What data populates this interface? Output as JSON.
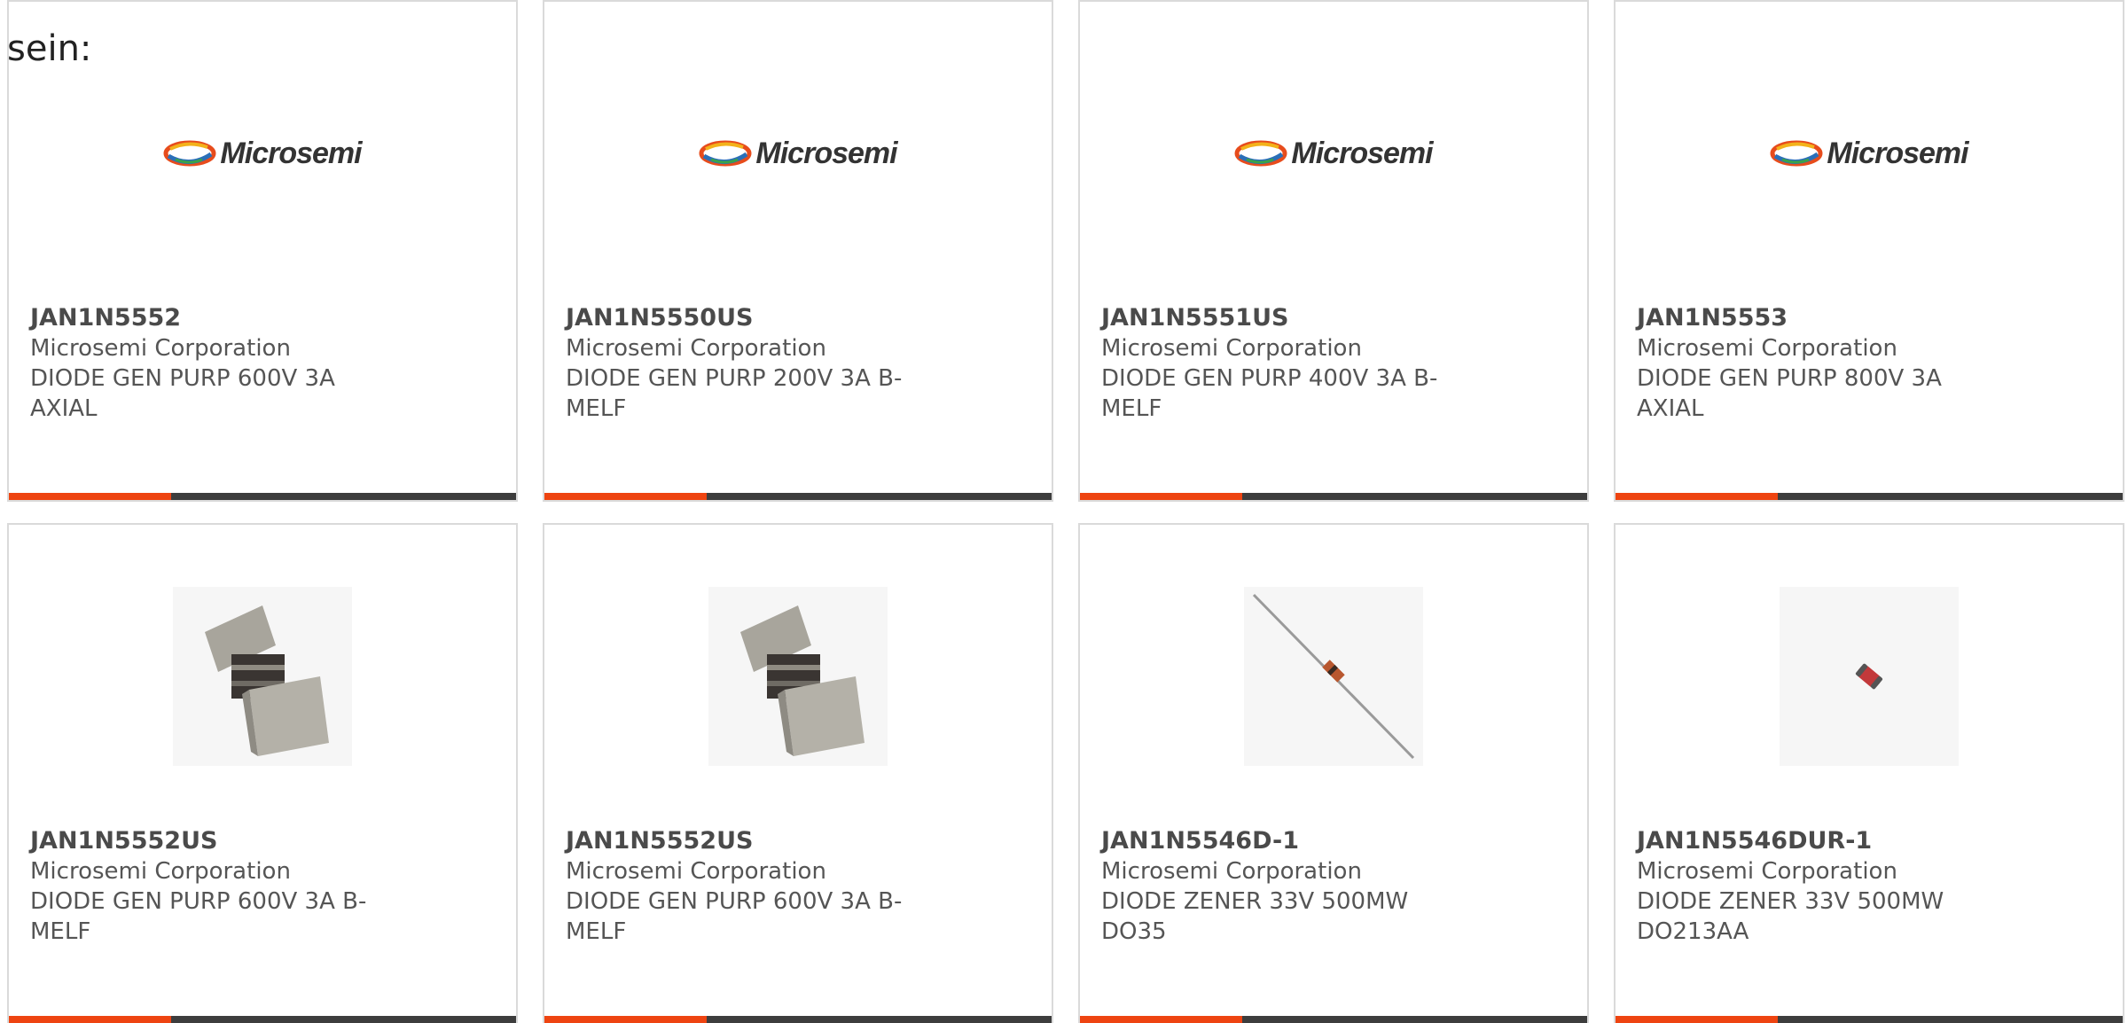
{
  "intro_text": "sein:",
  "logo_text": "Microsemi",
  "colors": {
    "accent": "#ee4411",
    "bar": "#3d3d3d",
    "border": "#dadada",
    "text": "#555555"
  },
  "cards": [
    {
      "part": "JAN1N5552",
      "manufacturer": "Microsemi Corporation",
      "description": "DIODE GEN PURP 600V 3A AXIAL",
      "image": "microsemi-logo"
    },
    {
      "part": "JAN1N5550US",
      "manufacturer": "Microsemi Corporation",
      "description": "DIODE GEN PURP 200V 3A B-MELF",
      "image": "microsemi-logo"
    },
    {
      "part": "JAN1N5551US",
      "manufacturer": "Microsemi Corporation",
      "description": "DIODE GEN PURP 400V 3A B-MELF",
      "image": "microsemi-logo"
    },
    {
      "part": "JAN1N5553",
      "manufacturer": "Microsemi Corporation",
      "description": "DIODE GEN PURP 800V 3A AXIAL",
      "image": "microsemi-logo"
    },
    {
      "part": "JAN1N5552US",
      "manufacturer": "Microsemi Corporation",
      "description": "DIODE GEN PURP 600V 3A B-MELF",
      "image": "b-melf-diode-photo"
    },
    {
      "part": "JAN1N5552US",
      "manufacturer": "Microsemi Corporation",
      "description": "DIODE GEN PURP 600V 3A B-MELF",
      "image": "b-melf-diode-photo"
    },
    {
      "part": "JAN1N5546D-1",
      "manufacturer": "Microsemi Corporation",
      "description": "DIODE ZENER 33V 500MW DO35",
      "image": "axial-diode-photo"
    },
    {
      "part": "JAN1N5546DUR-1",
      "manufacturer": "Microsemi Corporation",
      "description": "DIODE ZENER 33V 500MW DO213AA",
      "image": "melf-diode-photo"
    }
  ]
}
